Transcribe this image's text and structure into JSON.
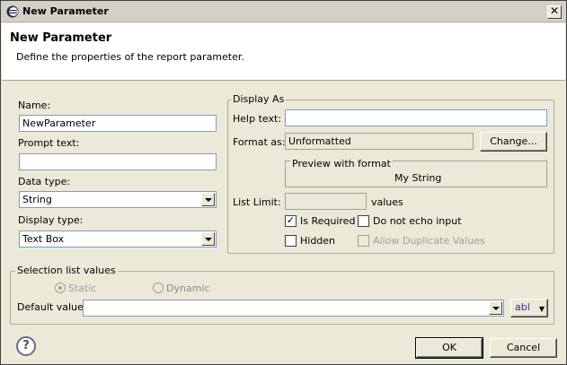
{
  "titlebar": {
    "title": "New Parameter",
    "close_glyph": "✕"
  },
  "header": {
    "title": "New Parameter",
    "description": "Define the properties of the report parameter."
  },
  "left": {
    "name_label": "Name:",
    "name_value": "NewParameter",
    "prompt_label": "Prompt text:",
    "prompt_value": "",
    "datatype_label": "Data type:",
    "datatype_value": "String",
    "displaytype_label": "Display type:",
    "displaytype_value": "Text Box"
  },
  "display_as": {
    "group_title": "Display As",
    "help_label": "Help text:",
    "help_value": "",
    "format_label": "Format as:",
    "format_value": "Unformatted",
    "change_button": "Change...",
    "preview_title": "Preview with format",
    "preview_value": "My String",
    "list_limit_label": "List Limit:",
    "list_limit_value": "",
    "values_label": "values",
    "is_required_label": "Is Required",
    "is_required_checked": true,
    "no_echo_label": "Do not echo input",
    "no_echo_checked": false,
    "hidden_label": "Hidden",
    "hidden_checked": false,
    "allow_dup_label": "Allow Duplicate Values",
    "allow_dup_checked": false
  },
  "selection": {
    "group_title": "Selection list values",
    "static_label": "Static",
    "dynamic_label": "Dynamic",
    "static_selected": true,
    "default_label": "Default value:",
    "default_value": "",
    "expr_button": "abl"
  },
  "footer": {
    "help_glyph": "?",
    "ok_button": "OK",
    "cancel_button": "Cancel"
  },
  "icons": {
    "app": "eclipse-icon",
    "close": "close-icon",
    "help": "help-icon",
    "combo": "chevron-down-icon"
  }
}
